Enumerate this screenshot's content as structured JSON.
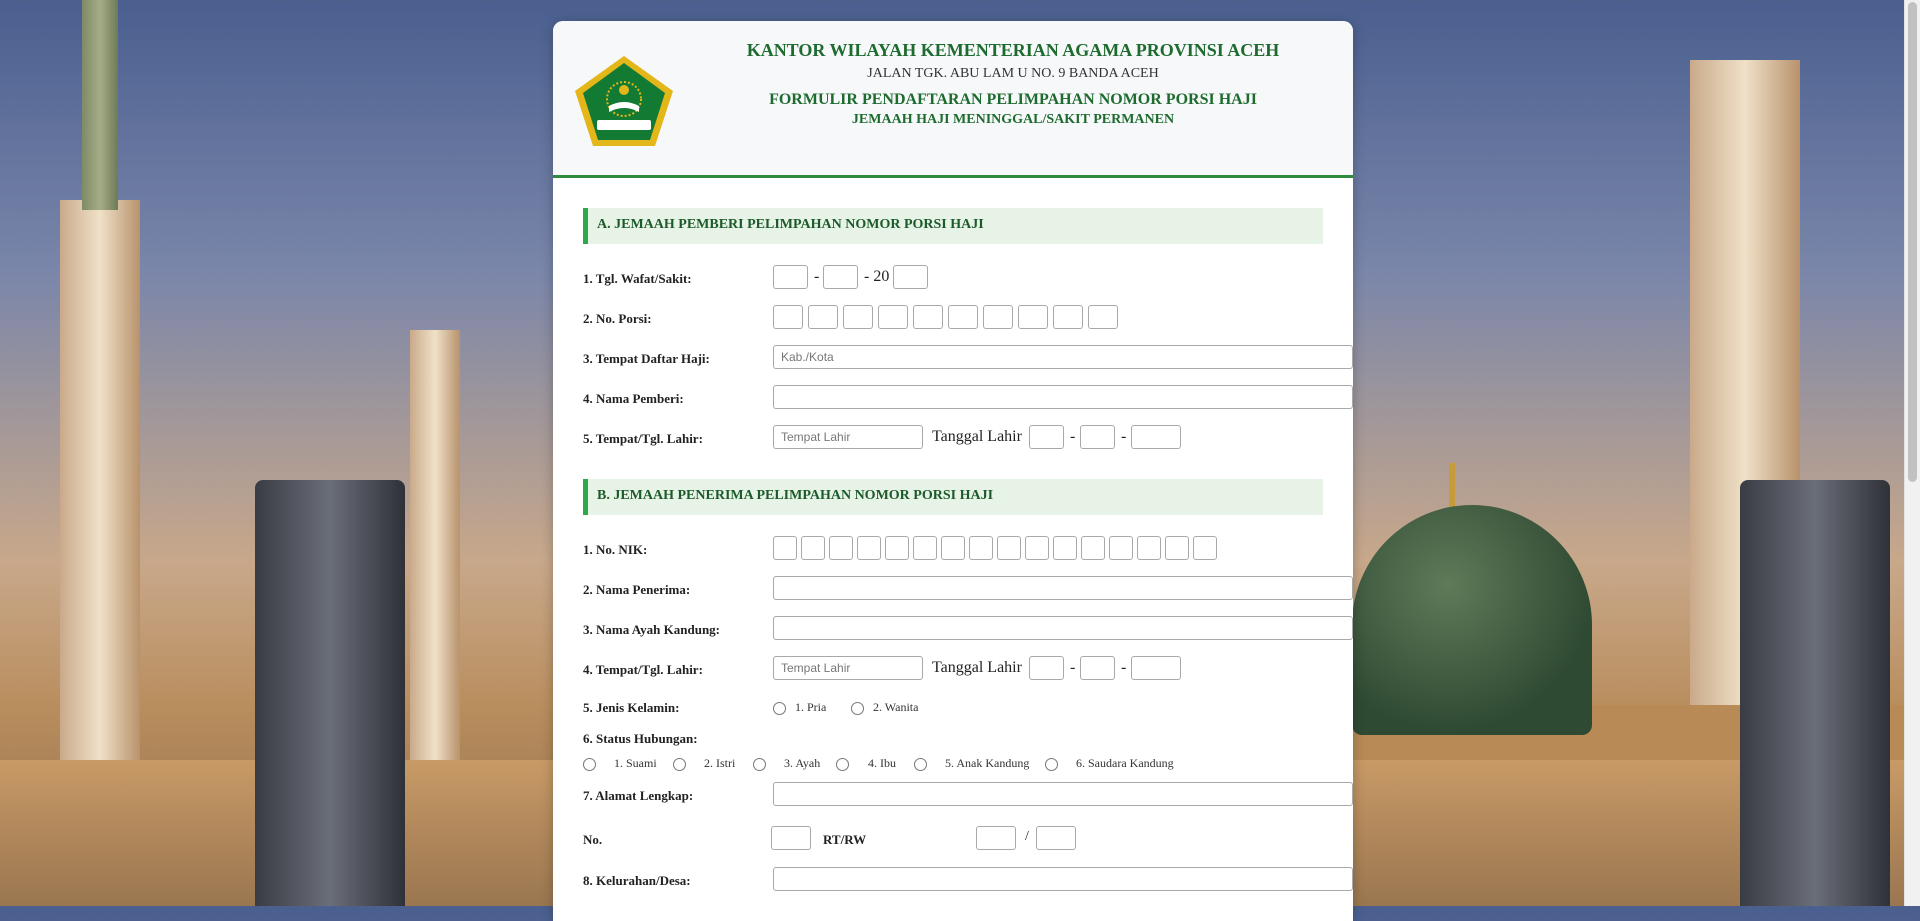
{
  "header": {
    "title": "KANTOR WILAYAH KEMENTERIAN AGAMA PROVINSI ACEH",
    "address": "JALAN TGK. ABU LAM U NO. 9 BANDA ACEH",
    "form_title": "FORMULIR PENDAFTARAN PELIMPAHAN NOMOR PORSI HAJI",
    "form_subtitle": "JEMAAH HAJI MENINGGAL/SAKIT PERMANEN",
    "logo_icon": "kemenag-emblem-icon",
    "logo_text": "IKHLAS BERAMAL"
  },
  "section_a": {
    "title": "A. JEMAAH PEMBERI PELIMPAHAN NOMOR PORSI HAJI",
    "tgl_label": "1. Tgl. Wafat/Sakit:",
    "tgl_sep": "-",
    "year_prefix": "- 20",
    "porsi_label": "2. No. Porsi:",
    "porsi_digits": 10,
    "tempat_daftar_label": "3. Tempat Daftar Haji:",
    "tempat_daftar_placeholder": "Kab./Kota",
    "nama_label": "4. Nama Pemberi:",
    "ttl_label": "5. Tempat/Tgl. Lahir:",
    "tempat_lahir_placeholder": "Tempat Lahir",
    "tanggal_lahir_label": "Tanggal Lahir",
    "date_sep": "-"
  },
  "section_b": {
    "title": "B. JEMAAH PENERIMA PELIMPAHAN NOMOR PORSI HAJI",
    "nik_label": "1. No. NIK:",
    "nik_digits": 16,
    "nama_label": "2. Nama Penerima:",
    "ayah_label": "3. Nama Ayah Kandung:",
    "ttl_label": "4. Tempat/Tgl. Lahir:",
    "tempat_lahir_placeholder": "Tempat Lahir",
    "tanggal_lahir_label": "Tanggal Lahir",
    "date_sep": "-",
    "jk_label": "5. Jenis Kelamin:",
    "jk_options": [
      "1. Pria",
      "2. Wanita"
    ],
    "status_label": "6. Status Hubungan:",
    "status_options": [
      "1. Suami",
      "2. Istri",
      "3. Ayah",
      "4. Ibu",
      "5. Anak Kandung",
      "6. Saudara Kandung"
    ],
    "alamat_label": "7. Alamat Lengkap:",
    "no_label": "No.",
    "rtrw_label": "RT/RW",
    "rtrw_sep": "/",
    "kelurahan_label": "8. Kelurahan/Desa:"
  }
}
